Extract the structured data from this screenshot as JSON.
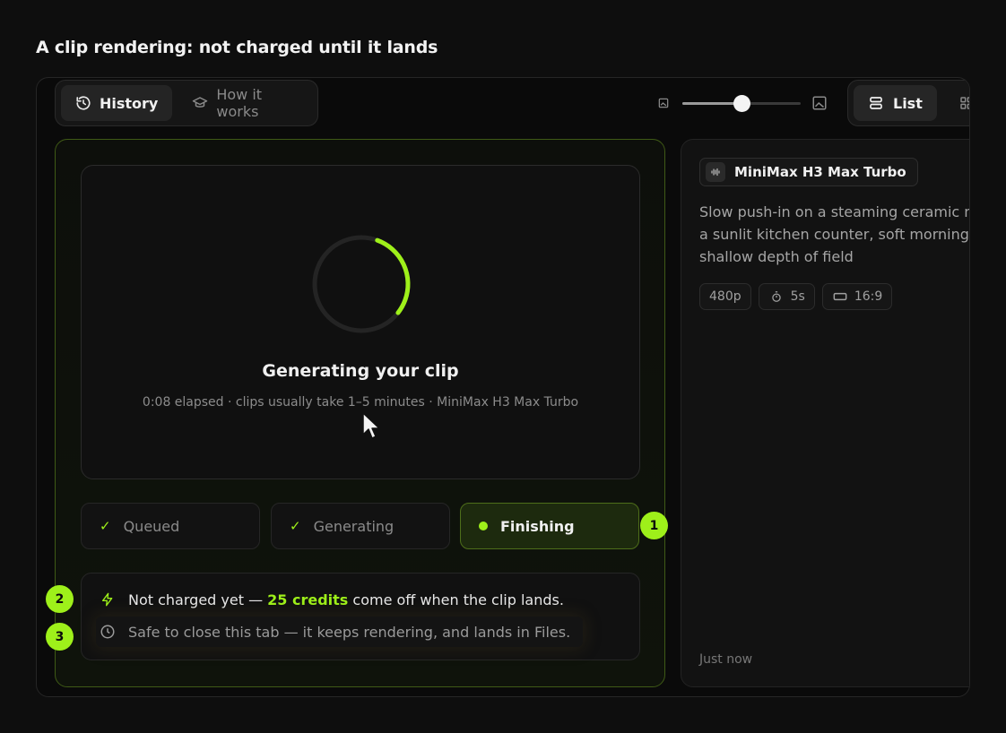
{
  "page": {
    "heading": "A clip rendering: not charged until it lands"
  },
  "toolbar": {
    "tabs": [
      {
        "label": "History",
        "icon": "history-icon",
        "active": true
      },
      {
        "label": "How it works",
        "icon": "graduation-cap-icon",
        "active": false
      }
    ],
    "size_slider": {
      "level": 0.5
    },
    "view": [
      {
        "label": "List",
        "icon": "list-icon",
        "active": true
      },
      {
        "label": "",
        "icon": "grid-icon",
        "active": false
      }
    ]
  },
  "job": {
    "progress_arc": 0.3,
    "title": "Generating your clip",
    "subtitle": "0:08 elapsed · clips usually take 1–5 minutes · MiniMax H3 Max Turbo",
    "steps": [
      {
        "label": "Queued",
        "state": "done"
      },
      {
        "label": "Generating",
        "state": "done"
      },
      {
        "label": "Finishing",
        "state": "active"
      }
    ],
    "charge_prefix": "Not charged yet — ",
    "charge_credits": "25 credits",
    "charge_suffix": " come off when the clip lands.",
    "close_note": "Safe to close this tab — it keeps rendering, and lands in Files."
  },
  "callouts": [
    "1",
    "2",
    "3"
  ],
  "side": {
    "model": "MiniMax H3 Max Turbo",
    "prompt_lines": [
      "Slow push-in on a steaming ceramic mu",
      "a sunlit kitchen counter, soft morning lig",
      "shallow depth of field"
    ],
    "tags": [
      {
        "label": "480p",
        "icon": ""
      },
      {
        "label": "5s",
        "icon": "stopwatch-icon"
      },
      {
        "label": "16:9",
        "icon": "aspect-ratio-icon"
      }
    ],
    "timestamp": "Just now"
  },
  "colors": {
    "accent": "#9ef01a",
    "background": "#0e0e0e",
    "card_border": "#3f5a16"
  }
}
